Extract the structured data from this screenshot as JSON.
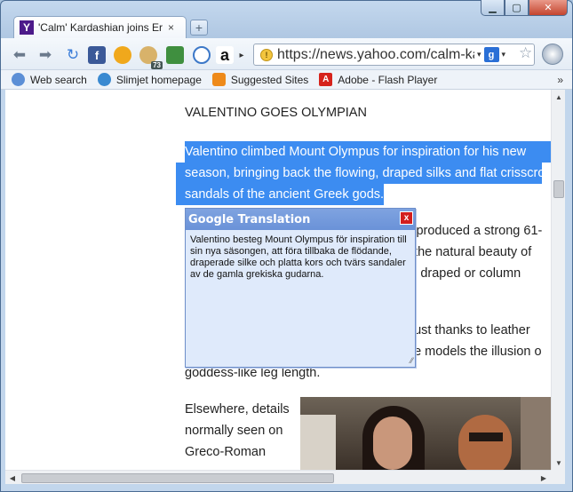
{
  "window": {
    "minimize_label": "▁",
    "maximize_label": "▢",
    "close_label": "✕"
  },
  "tab": {
    "favicon_letter": "Y",
    "title": "'Calm' Kardashian joins Er",
    "close_label": "×",
    "new_tab_label": "+"
  },
  "toolbar": {
    "back_label": "⬅",
    "forward_label": "➡",
    "reload_label": "↻",
    "facebook_label": "f",
    "badge_label": "73",
    "amazon_label": "a",
    "more_label": "▸",
    "omnibox_url": "https://news.yahoo.com/calm-ka",
    "omnibox_dropdown": "▾",
    "search_engine_label": "g",
    "star_label": "☆"
  },
  "bookmarks": {
    "items": [
      {
        "label": "Web search",
        "icon": "web-search-icon"
      },
      {
        "label": "Slimjet homepage",
        "icon": "globe-icon"
      },
      {
        "label": "Suggested Sites",
        "icon": "suggested-sites-icon"
      },
      {
        "label": "Adobe - Flash Player",
        "icon": "adobe-icon"
      }
    ],
    "overflow_label": "»"
  },
  "article": {
    "heading": "VALENTINO GOES OLYMPIAN",
    "highlight_lines": [
      "Valentino climbed Mount Olympus for inspiration for his new",
      "season, bringing back the flowing, draped silks and flat crisscros",
      "sandals of the ancient Greek gods."
    ],
    "partial_lines": [
      "li produced a strong 61-",
      "f the natural beauty of",
      "in draped or column",
      "bust thanks to leather",
      "he models the illusion o",
      "goddess-like leg length."
    ],
    "bottom_lines": [
      "Elsewhere, details",
      "normally seen on",
      "Greco-Roman"
    ]
  },
  "translation_popup": {
    "title": "Google Translation",
    "close_label": "x",
    "text": "Valentino besteg Mount Olympus för inspiration till sin nya säsongen, att föra tillbaka de flödande, draperade silke och platta kors och tvärs sandaler av de gamla grekiska gudarna.",
    "resize_label": "⁄⁄"
  },
  "scrollbars": {
    "up": "▲",
    "down": "▼",
    "left": "◀",
    "right": "▶"
  }
}
